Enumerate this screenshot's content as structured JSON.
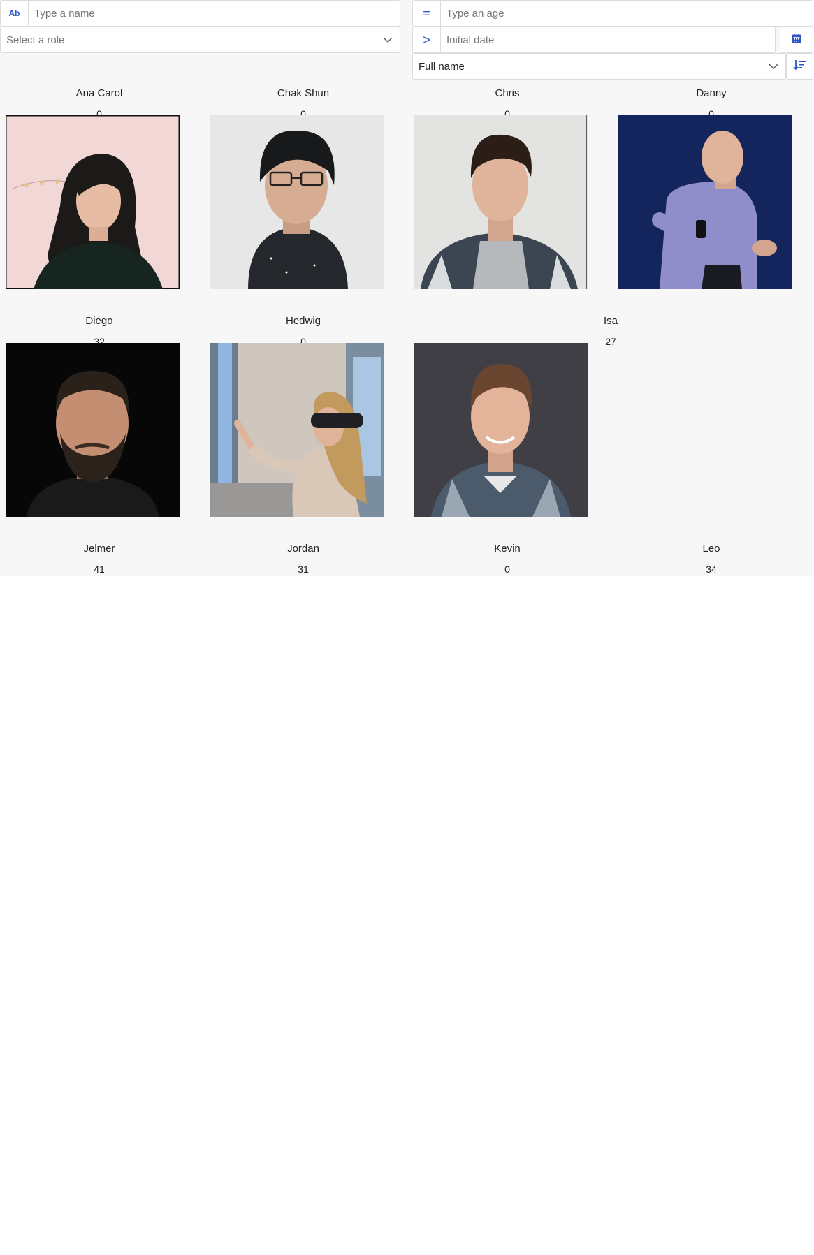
{
  "filters": {
    "name": {
      "prefix": "Ab",
      "placeholder": "Type a name",
      "value": ""
    },
    "role": {
      "placeholder": "Select a role"
    },
    "age": {
      "prefix": "=",
      "placeholder": "Type an age",
      "value": ""
    },
    "date": {
      "prefix": ">",
      "placeholder": "Initial date",
      "value": "",
      "button_icon": "calendar-icon"
    },
    "sort": {
      "value": "Full name",
      "button_icon": "sort-descending-icon"
    }
  },
  "people": [
    {
      "name": "Ana Carol",
      "age": "0",
      "photo": "portrait-woman-pink-background"
    },
    {
      "name": "Chak Shun",
      "age": "0",
      "photo": "portrait-man-glasses-snow"
    },
    {
      "name": "Chris",
      "age": "0",
      "photo": "portrait-man-plaid-shirt"
    },
    {
      "name": "Danny",
      "age": "0",
      "photo": "portrait-man-presenting-stage"
    },
    {
      "name": "Diego",
      "age": "32",
      "photo": "portrait-man-beard-dark"
    },
    {
      "name": "Hedwig",
      "age": "0",
      "photo": "portrait-woman-headset"
    },
    {
      "name": "Isa",
      "age": "27",
      "photo": "portrait-man-checked-shirt"
    },
    {
      "name": "Jelmer",
      "age": "41"
    },
    {
      "name": "Jordan",
      "age": "31"
    },
    {
      "name": "Kevin",
      "age": "0"
    },
    {
      "name": "Leo",
      "age": "34"
    }
  ],
  "colors": {
    "accent": "#2d55c8",
    "page_background": "#f7f7f7"
  }
}
